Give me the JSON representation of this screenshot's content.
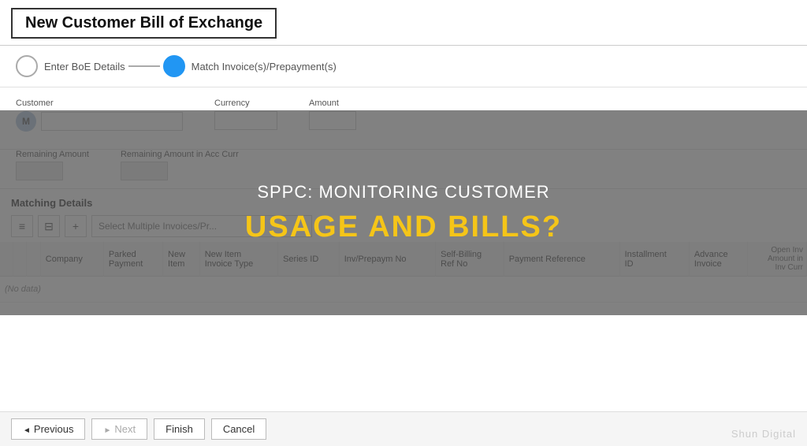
{
  "page": {
    "title": "New Customer Bill of Exchange"
  },
  "wizard": {
    "step1": {
      "label": "Enter BoE Details",
      "state": "inactive"
    },
    "step2": {
      "label": "Match Invoice(s)/Prepayment(s)",
      "state": "active"
    }
  },
  "form": {
    "customer_label": "Customer",
    "customer_value": "",
    "customer_avatar": "M",
    "currency_label": "Currency",
    "currency_value": "",
    "amount_label": "Amount",
    "amount_value": "",
    "remaining_amount_label": "Remaining Amount",
    "remaining_amount_value": "",
    "remaining_acc_curr_label": "Remaining Amount in Acc Curr",
    "remaining_acc_curr_value": ""
  },
  "matching": {
    "title": "Matching Details",
    "select_placeholder": "Select Multiple Invoices/Pr...",
    "toolbar": {
      "list_icon": "≡",
      "filter_icon": "⊟",
      "add_icon": "+"
    }
  },
  "table": {
    "open_inv_header": "Open Inv",
    "columns": [
      "",
      "",
      "",
      "Company",
      "Parked Payment",
      "New Item",
      "New Item Invoice Type",
      "Series ID",
      "Inv/Prepaym No",
      "Self-Billing Ref No",
      "Payment Reference",
      "Installment ID",
      "Advance Invoice",
      "Amount in Inv Curr"
    ],
    "no_data": "(No data)"
  },
  "footer": {
    "previous_label": "Previous",
    "next_label": "Next",
    "finish_label": "Finish",
    "cancel_label": "Cancel"
  },
  "overlay": {
    "subtitle": "SPPC: MONITORING CUSTOMER",
    "title": "USAGE AND BILLS?"
  },
  "watermark": "Shun Digital"
}
